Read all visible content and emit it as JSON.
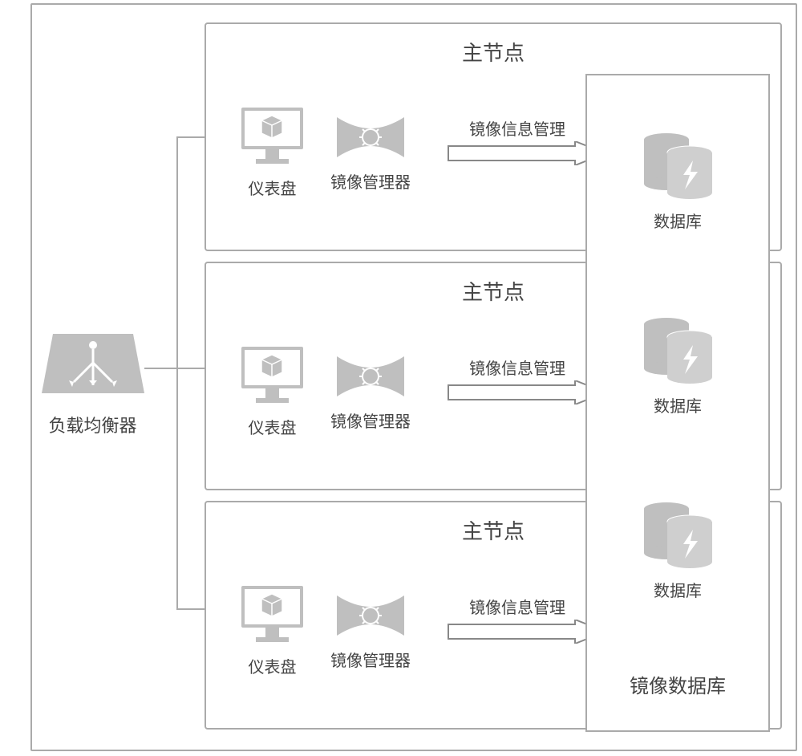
{
  "loadBalancer": {
    "label": "负载均衡器"
  },
  "nodes": [
    {
      "title": "主节点",
      "dashboard": {
        "label": "仪表盘"
      },
      "manager": {
        "label": "镜像管理器"
      },
      "arrowLabel": "镜像信息管理",
      "db": {
        "label": "数据库"
      }
    },
    {
      "title": "主节点",
      "dashboard": {
        "label": "仪表盘"
      },
      "manager": {
        "label": "镜像管理器"
      },
      "arrowLabel": "镜像信息管理",
      "db": {
        "label": "数据库"
      }
    },
    {
      "title": "主节点",
      "dashboard": {
        "label": "仪表盘"
      },
      "manager": {
        "label": "镜像管理器"
      },
      "arrowLabel": "镜像信息管理",
      "db": {
        "label": "数据库"
      }
    }
  ],
  "dbRegion": {
    "label": "镜像数据库"
  }
}
